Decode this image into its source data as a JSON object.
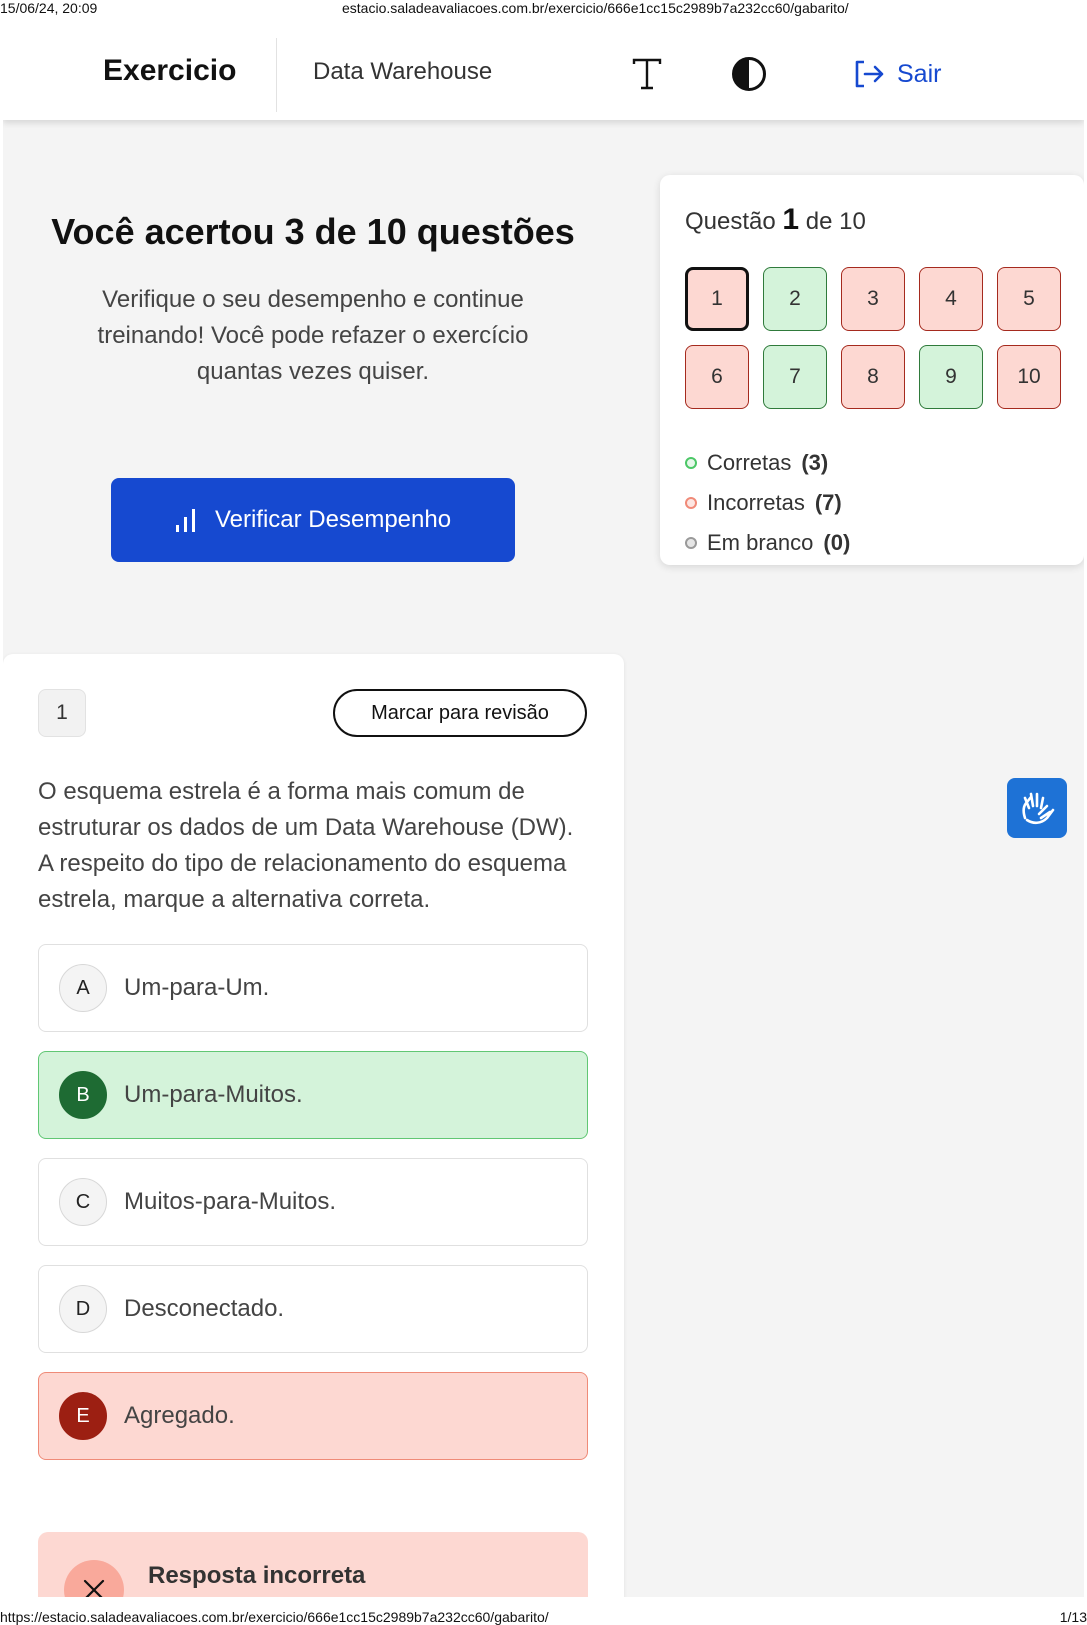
{
  "print": {
    "date": "15/06/24, 20:09",
    "header_url": "estacio.saladeavaliacoes.com.br/exercicio/666e1cc15c2989b7a232cc60/gabarito/",
    "footer_url": "https://estacio.saladeavaliacoes.com.br/exercicio/666e1cc15c2989b7a232cc60/gabarito/",
    "page": "1/13"
  },
  "topbar": {
    "brand": "Exercicio",
    "course": "Data Warehouse",
    "font_icon": "font-size-icon",
    "contrast_icon": "contrast-icon",
    "logout_icon": "logout-icon",
    "logout_label": "Sair"
  },
  "result": {
    "title": "Você acertou 3 de 10 questões",
    "message": "Verifique o seu desempenho e continue treinando! Você pode refazer o exercício quantas vezes quiser.",
    "button_label": "Verificar Desempenho",
    "button_icon": "bar-chart-icon"
  },
  "navigator": {
    "prefix": "Questão",
    "current": "1",
    "suffix": "de 10",
    "questions": [
      {
        "label": "1",
        "status": "incorrect",
        "current": true
      },
      {
        "label": "2",
        "status": "correct",
        "current": false
      },
      {
        "label": "3",
        "status": "incorrect",
        "current": false
      },
      {
        "label": "4",
        "status": "incorrect",
        "current": false
      },
      {
        "label": "5",
        "status": "incorrect",
        "current": false
      },
      {
        "label": "6",
        "status": "incorrect",
        "current": false
      },
      {
        "label": "7",
        "status": "correct",
        "current": false
      },
      {
        "label": "8",
        "status": "incorrect",
        "current": false
      },
      {
        "label": "9",
        "status": "correct",
        "current": false
      },
      {
        "label": "10",
        "status": "incorrect",
        "current": false
      }
    ],
    "legend": [
      {
        "label": "Corretas",
        "count": "(3)",
        "color": "#4cc767",
        "fill": "#e6f8ea"
      },
      {
        "label": "Incorretas",
        "count": "(7)",
        "color": "#f08a78",
        "fill": "#fde6e2"
      },
      {
        "label": "Em branco",
        "count": "(0)",
        "color": "#9a9a9a",
        "fill": "#e6e6e6"
      }
    ]
  },
  "question": {
    "number": "1",
    "review_label": "Marcar para revisão",
    "text": "O esquema estrela é a forma mais comum de estruturar os dados de um Data Warehouse (DW). A respeito do tipo de relacionamento do esquema estrela, marque a alternativa correta.",
    "options": [
      {
        "letter": "A",
        "text": "Um-para-Um.",
        "state": "neutral"
      },
      {
        "letter": "B",
        "text": "Um-para-Muitos.",
        "state": "correct"
      },
      {
        "letter": "C",
        "text": "Muitos-para-Muitos.",
        "state": "neutral"
      },
      {
        "letter": "D",
        "text": "Desconectado.",
        "state": "neutral"
      },
      {
        "letter": "E",
        "text": "Agregado.",
        "state": "incorrect"
      }
    ],
    "feedback_label": "Resposta incorreta",
    "feedback_icon": "close-icon"
  },
  "accessibility": {
    "icon": "sign-language-icon"
  },
  "colors": {
    "accent": "#1649d0",
    "correct_bg": "#d4f3da",
    "incorrect_bg": "#fdd8d2"
  }
}
